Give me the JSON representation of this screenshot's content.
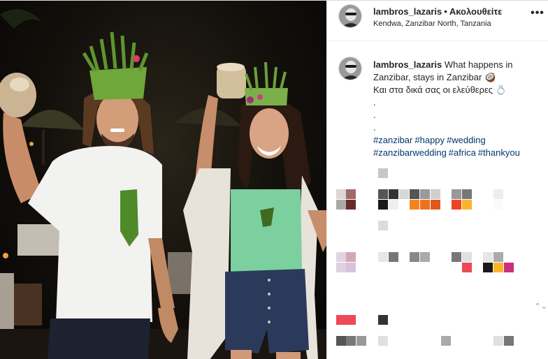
{
  "post": {
    "username": "lambros_lazaris",
    "separator": "•",
    "follow_status": "Ακολουθείτε",
    "location": "Kendwa, Zanzibar North, Tanzania",
    "more_label": "•••",
    "caption": {
      "username": "lambros_lazaris",
      "line1": "What happens in Zanzibar, stays in Zanzibar 🥥",
      "line2": "Και στα δικά σας οι ελεύθερες 💍",
      "dots": [
        ".",
        ".",
        "."
      ],
      "hashtags_line1": [
        "#zanzibar",
        "#happy",
        "#wedding"
      ],
      "hashtags_line2": [
        "#zanzibarwedding",
        "#africa",
        "#thankyou"
      ]
    },
    "scroll_arrow": "⌃⌄"
  },
  "colors": {
    "link": "#00376b",
    "border": "#efefef",
    "pixel_red": "#ed4956",
    "pixel_orange": "#f5821f",
    "pixel_yellow": "#fcb32c",
    "pixel_magenta": "#c8317a"
  },
  "icons": {
    "more": "more-icon",
    "avatar": "avatar-icon"
  }
}
